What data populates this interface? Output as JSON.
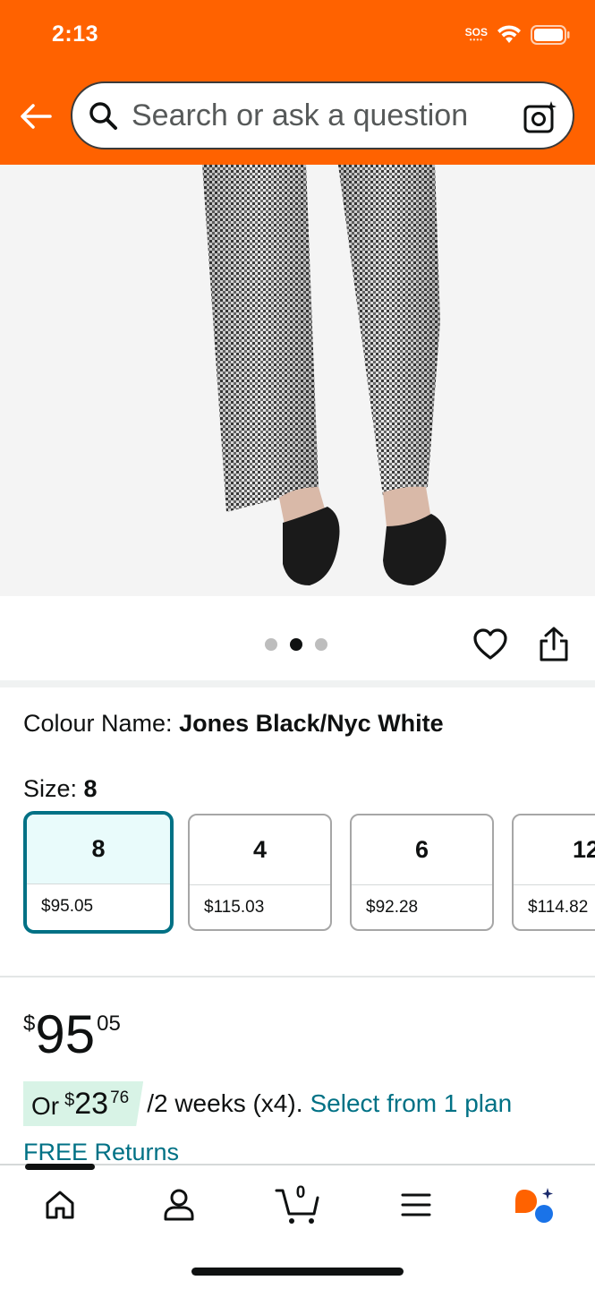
{
  "status_bar": {
    "time": "2:13",
    "sos": "SOS"
  },
  "search": {
    "placeholder": "Search or ask a question"
  },
  "carousel": {
    "total": 3,
    "active_index": 1
  },
  "variations": {
    "colour_label": "Colour Name: ",
    "colour_value": "Jones Black/Nyc White",
    "size_label": "Size: ",
    "size_value": "8",
    "sizes": [
      {
        "size": "8",
        "price": "$95.05",
        "selected": true
      },
      {
        "size": "4",
        "price": "$115.03",
        "selected": false
      },
      {
        "size": "6",
        "price": "$92.28",
        "selected": false
      },
      {
        "size": "12",
        "price": "$114.82",
        "selected": false
      }
    ]
  },
  "price": {
    "currency": "$",
    "whole": "95",
    "fraction": "05"
  },
  "installment": {
    "or": "Or",
    "currency": "$",
    "whole": "23",
    "fraction": "76",
    "period": "/2 weeks (x4).",
    "plan_link": "Select from 1 plan"
  },
  "returns": {
    "label": "FREE Returns"
  },
  "bottom_nav": {
    "cart_count": "0",
    "items": [
      "home-icon",
      "account-icon",
      "cart-icon",
      "menu-icon",
      "rufus-assistant-icon"
    ]
  },
  "colors": {
    "brand_orange": "#ff6200",
    "link_teal": "#007185",
    "selected_border": "#007185",
    "installment_badge": "#d8f3e6"
  }
}
